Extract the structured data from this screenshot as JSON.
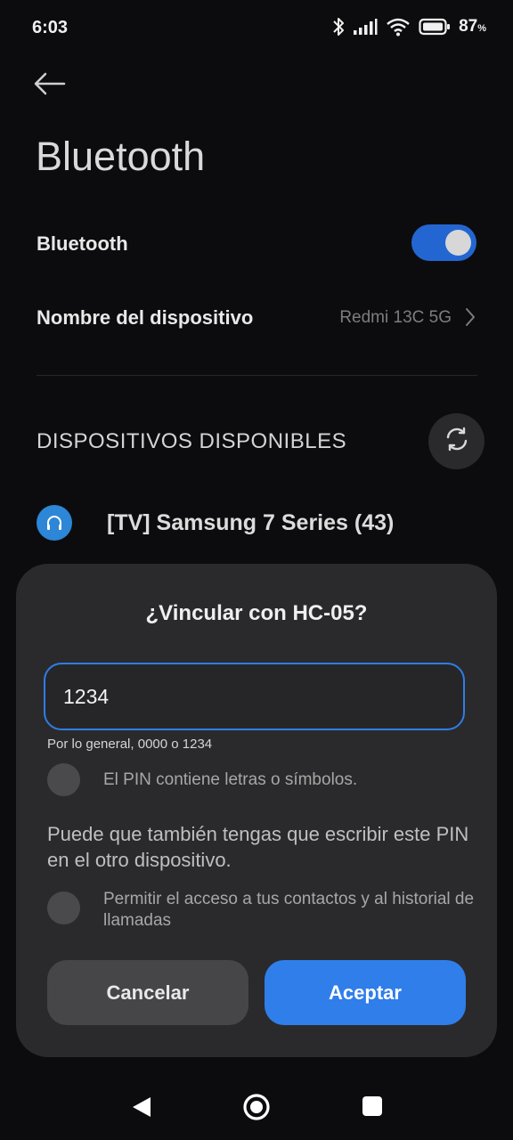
{
  "status_bar": {
    "time": "6:03",
    "battery_number": "87",
    "battery_unit": "%",
    "icons": [
      "bluetooth-icon",
      "signal-icon",
      "wifi-icon",
      "battery-icon"
    ]
  },
  "header": {
    "back_icon": "arrow-left-icon",
    "title": "Bluetooth"
  },
  "settings": {
    "bluetooth_label": "Bluetooth",
    "bluetooth_enabled": true,
    "device_name_label": "Nombre del dispositivo",
    "device_name_value": "Redmi 13C 5G"
  },
  "available": {
    "section_title": "DISPOSITIVOS DISPONIBLES",
    "refresh_icon": "refresh-icon",
    "devices": [
      {
        "icon": "headphones-icon",
        "name": "[TV] Samsung 7 Series (43)"
      }
    ]
  },
  "pair_dialog": {
    "title": "¿Vincular con HC-05?",
    "pin_value": "1234",
    "pin_hint": "Por lo general, 0000 o 1234",
    "pin_letters_label": "El PIN contiene letras o símbolos.",
    "pin_letters_checked": false,
    "note": "Puede que también tengas que escribir este PIN en el otro dispositivo.",
    "contacts_label": "Permitir el acceso a tus contactos y al historial de llamadas",
    "contacts_checked": false,
    "cancel_label": "Cancelar",
    "accept_label": "Aceptar"
  },
  "colors": {
    "background": "#0c0c0e",
    "dialog": "#2a2a2c",
    "accent": "#2f7eea",
    "toggle_on": "#2466d1",
    "device_icon": "#2d86d6"
  },
  "nav_bar": {
    "icons": [
      "nav-back-icon",
      "nav-home-icon",
      "nav-recents-icon"
    ]
  }
}
